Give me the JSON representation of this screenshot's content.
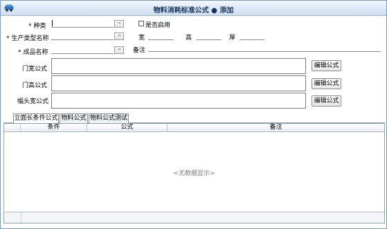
{
  "window": {
    "title": "物料消耗标准公式 ● 添加"
  },
  "form": {
    "required_mark": "*",
    "category_label": "种类",
    "category_value": "",
    "production_type_label": "生产类型名称",
    "production_type_value": "",
    "product_name_label": "成品名称",
    "product_name_value": "",
    "browse_button": "···",
    "enabled_label": "是否启用",
    "enabled_checked": false,
    "width_label": "宽",
    "height_label": "高",
    "thickness_label": "厚",
    "remark_label": "备注",
    "door_width_formula_label": "门宽公式",
    "door_height_formula_label": "门高公式",
    "head_width_formula_label": "幅头宽公式",
    "edit_formula_button": "编辑公式"
  },
  "tabs": [
    {
      "label": "立面长条件公式",
      "active": true
    },
    {
      "label": "物料公式",
      "active": false
    },
    {
      "label": "物料公式测试",
      "active": false
    }
  ],
  "grid": {
    "columns": [
      "条件",
      "公式",
      "备注"
    ],
    "empty_text": "<无数据显示>",
    "rows": []
  },
  "icons": {
    "app": "car-icon",
    "browse": "ellipsis-icon",
    "checkbox": "checkbox-icon"
  },
  "colors": {
    "title_text": "#15325a",
    "border": "#7d98b8"
  }
}
